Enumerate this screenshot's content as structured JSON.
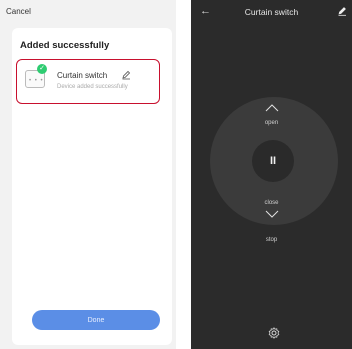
{
  "left": {
    "cancel_label": "Cancel",
    "card_title": "Added successfully",
    "device_name": "Curtain switch",
    "device_status": "Device added successfully",
    "done_label": "Done"
  },
  "right": {
    "title": "Curtain switch",
    "open_label": "open",
    "close_label": "close",
    "stop_label": "stop",
    "pause_symbol": "II"
  },
  "icons": [
    "back-arrow-icon",
    "edit-icon",
    "check-icon",
    "device-icon",
    "chevron-up-icon",
    "chevron-down-icon",
    "gear-icon"
  ],
  "colors": {
    "accent": "#5b8ee6",
    "highlight": "#c8102e",
    "success": "#2ecc71",
    "dark_bg": "#2b2b2b"
  }
}
